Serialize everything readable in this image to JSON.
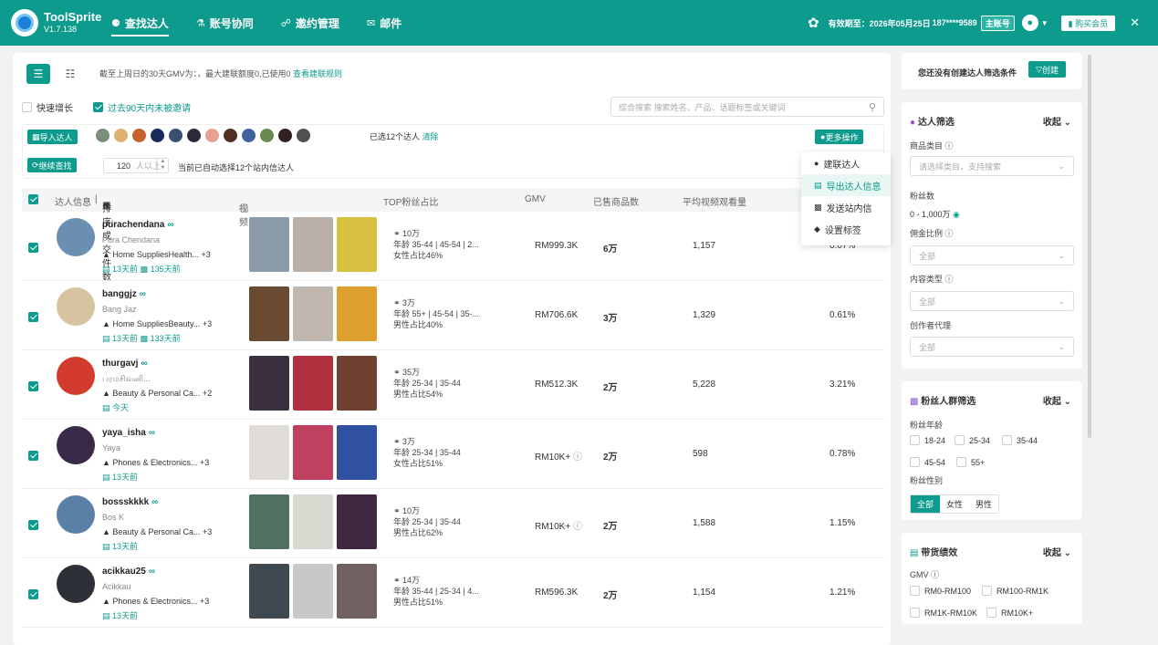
{
  "app": {
    "name": "ToolSprite",
    "version": "V1.7.138"
  },
  "nav": [
    {
      "icon": "users-icon",
      "label": "查找达人",
      "active": true
    },
    {
      "icon": "team-icon",
      "label": "账号协同",
      "active": false
    },
    {
      "icon": "invite-icon",
      "label": "邀约管理",
      "active": false
    },
    {
      "icon": "mail-icon",
      "label": "邮件",
      "active": false
    }
  ],
  "topbar": {
    "expiry": "有效期至：2026年05月25日",
    "phone": "187****9589",
    "account_badge": "主账号",
    "buy_label": "购买会员",
    "close": "✕"
  },
  "toolbar_top": {
    "summary_text": "截至上周日的30天GMV为：，最大建联额度0,已使用0",
    "summary_link": "查看建联规则",
    "quick_growth": "快速增长",
    "not_invited": "过去90天内未被邀请",
    "search_placeholder": "综合搜索 搜索姓名、产品、话题标签或关键词"
  },
  "toolbar": {
    "import_label": "导入达人",
    "selected_text": "已选12个达人",
    "clear_label": "清除",
    "more_label": "更多操作",
    "continue_label": "继续查找",
    "count_value": "120",
    "count_placeholder": "人以上",
    "auto_text": "当前已自动选择12个站内信达人"
  },
  "more_menu": [
    {
      "icon": "person-icon",
      "label": "建联达人"
    },
    {
      "icon": "export-icon",
      "label": "导出达人信息"
    },
    {
      "icon": "message-icon",
      "label": "发送站内信"
    },
    {
      "icon": "tag-icon",
      "label": "设置标签"
    }
  ],
  "table": {
    "headers": {
      "info": "达人信息",
      "sort": "排序: 成交件数",
      "video": "视频",
      "fans": "TOP粉丝占比",
      "gmv": "GMV",
      "sold": "已售商品数",
      "avg": "平均视频观看量"
    },
    "rows": [
      {
        "handle": "purachendana",
        "name": "Pura Chendana",
        "category": "Home SuppliesHealth... +3",
        "last_active": "13天前",
        "msgs": "135天前",
        "fans": "10万",
        "age": "年龄 35-44 | 45-54 | 2...",
        "gender": "女性占比46%",
        "gmv": "RM999.3K",
        "sold": "6万",
        "avg": "1,157",
        "rate": "0.07%",
        "avatar_color": "#6a8fb0"
      },
      {
        "handle": "banggjz",
        "name": "Bang Jaz",
        "category": "Home SuppliesBeauty... +3",
        "last_active": "13天前",
        "msgs": "133天前",
        "fans": "3万",
        "age": "年龄 55+ | 45-54 | 35-...",
        "gender": "男性占比40%",
        "gmv": "RM706.6K",
        "sold": "3万",
        "avg": "1,329",
        "rate": "0.61%",
        "avatar_color": "#d8c3a0"
      },
      {
        "handle": "thurgavj",
        "name": "பரமசிவனி...",
        "category": "Beauty & Personal Ca... +2",
        "last_active": "今天",
        "msgs": "",
        "fans": "35万",
        "age": "年龄 25-34 | 35-44",
        "gender": "男性占比54%",
        "gmv": "RM512.3K",
        "sold": "2万",
        "avg": "5,228",
        "rate": "3.21%",
        "avatar_color": "#d23b2c"
      },
      {
        "handle": "yaya_isha",
        "name": "Yaya",
        "category": "Phones & Electronics... +3",
        "last_active": "13天前",
        "msgs": "",
        "fans": "3万",
        "age": "年龄 25-34 | 35-44",
        "gender": "女性占比51%",
        "gmv": "RM10K+",
        "sold": "2万",
        "avg": "598",
        "rate": "0.78%",
        "avatar_color": "#3a2a4a"
      },
      {
        "handle": "bossskkkk",
        "name": "Bos K",
        "category": "Beauty & Personal Ca... +3",
        "last_active": "13天前",
        "msgs": "",
        "fans": "10万",
        "age": "年龄 25-34 | 35-44",
        "gender": "男性占比62%",
        "gmv": "RM10K+",
        "sold": "2万",
        "avg": "1,588",
        "rate": "1.15%",
        "avatar_color": "#5a80a8"
      },
      {
        "handle": "acikkau25",
        "name": "Acikkau",
        "category": "Phones & Electronics... +3",
        "last_active": "13天前",
        "msgs": "",
        "fans": "14万",
        "age": "年龄 35-44 | 25-34 | 4...",
        "gender": "男性占比51%",
        "gmv": "RM596.3K",
        "sold": "2万",
        "avg": "1,154",
        "rate": "1.21%",
        "avatar_color": "#2e3038"
      }
    ]
  },
  "sidebar": {
    "no_filter": "您还没有创建达人筛选条件",
    "create_label": "创建",
    "filter_title": "达人筛选",
    "collapse": "收起",
    "product_cat": "商品类目",
    "product_placeholder": "请选择类目，支持搜索",
    "fans_label": "粉丝数",
    "fans_range": "0 - 1,000万",
    "commission": "佣金比例",
    "all": "全部",
    "content_type": "内容类型",
    "agent": "创作者代理",
    "audience_title": "粉丝人群筛选",
    "age_label": "粉丝年龄",
    "ages": [
      "18-24",
      "25-34",
      "35-44",
      "45-54",
      "55+"
    ],
    "gender_label": "粉丝性别",
    "genders": [
      "全部",
      "女性",
      "男性"
    ],
    "perf_title": "带货绩效",
    "gmv_label": "GMV",
    "gmv_opts": [
      "RM0-RM100",
      "RM100-RM1K",
      "RM1K-RM10K",
      "RM10K+"
    ]
  }
}
